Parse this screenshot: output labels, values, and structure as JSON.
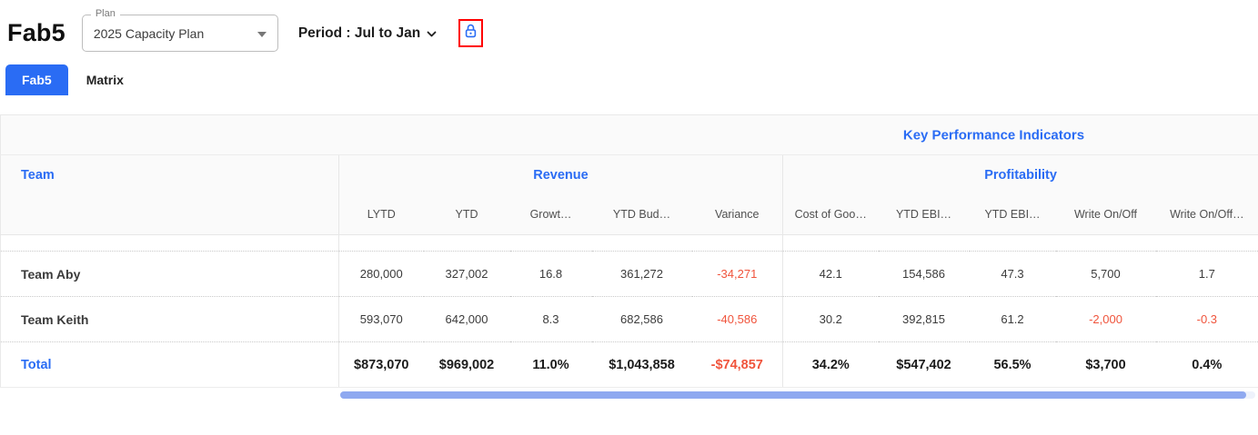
{
  "header": {
    "app_title": "Fab5",
    "plan": {
      "label": "Plan",
      "value": "2025 Capacity Plan"
    },
    "period": {
      "label": "Period : Jul to Jan"
    },
    "icons": {
      "plan_caret": "caret-down-icon",
      "period_chevron": "chevron-down-icon",
      "lock": "lock-icon"
    }
  },
  "tabs": [
    {
      "label": "Fab5",
      "active": true
    },
    {
      "label": "Matrix",
      "active": false
    }
  ],
  "table": {
    "kpi_header": "Key Performance Indicators",
    "team_column_header": "Team",
    "groups": {
      "revenue": "Revenue",
      "profitability": "Profitability"
    },
    "columns": [
      "LYTD",
      "YTD",
      "Growt…",
      "YTD Bud…",
      "Variance",
      "Cost of Goo…",
      "YTD EBI…",
      "YTD EBI…",
      "Write On/Off",
      "Write On/Off…"
    ],
    "rows": [
      {
        "name": "Team Aby",
        "values": [
          "280,000",
          "327,002",
          "16.8",
          "361,272",
          "-34,271",
          "42.1",
          "154,586",
          "47.3",
          "5,700",
          "1.7"
        ]
      },
      {
        "name": "Team Keith",
        "values": [
          "593,070",
          "642,000",
          "8.3",
          "682,586",
          "-40,586",
          "30.2",
          "392,815",
          "61.2",
          "-2,000",
          "-0.3"
        ]
      }
    ],
    "total_row": {
      "name": "Total",
      "values": [
        "$873,070",
        "$969,002",
        "11.0%",
        "$1,043,858",
        "-$74,857",
        "34.2%",
        "$547,402",
        "56.5%",
        "$3,700",
        "0.4%"
      ]
    }
  },
  "colors": {
    "accent_blue": "#2a6cf4",
    "negative_red": "#f0543c",
    "annotation_red": "#ff0000",
    "header_bg": "#fafafa",
    "scrollbar_thumb": "#8fa9f0"
  }
}
